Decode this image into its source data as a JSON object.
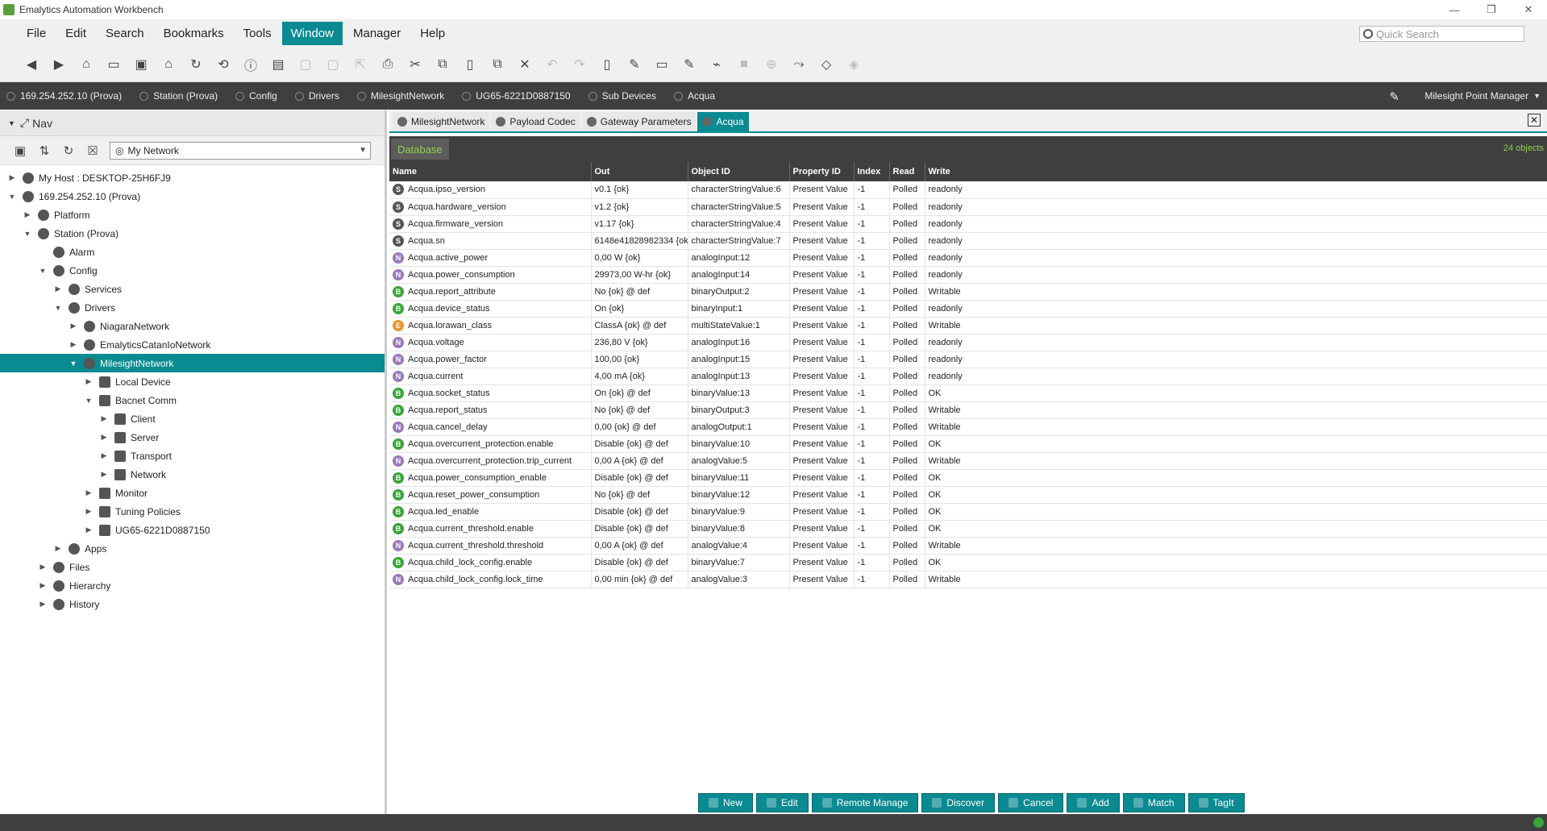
{
  "window": {
    "title": "Emalytics Automation Workbench",
    "btn_min": "—",
    "btn_max": "❐",
    "btn_close": "✕"
  },
  "menubar": {
    "items": [
      "File",
      "Edit",
      "Search",
      "Bookmarks",
      "Tools",
      "Window",
      "Manager",
      "Help"
    ],
    "active_index": 5,
    "quick_search_placeholder": "Quick Search"
  },
  "toolbar": {
    "icons": [
      "back-icon",
      "forward-icon",
      "home-folder-icon",
      "layout-icon",
      "capture-icon",
      "home-icon",
      "refresh-icon",
      "history-icon",
      "info-icon",
      "open-folder-icon",
      "save-icon",
      "save-all-icon",
      "export-icon",
      "print-icon",
      "cut-icon",
      "copy-icon",
      "paste-icon",
      "duplicate-icon",
      "delete-icon",
      "undo-icon",
      "redo-icon",
      "new-doc-icon",
      "rename-icon",
      "window-icon",
      "edit-pen-icon",
      "plug-icon",
      "stop-icon",
      "target-icon",
      "link-icon",
      "tag-icon",
      "tag-search-icon"
    ]
  },
  "pathbar": {
    "crumbs": [
      "169.254.252.10 (Prova)",
      "Station (Prova)",
      "Config",
      "Drivers",
      "MilesightNetwork",
      "UG65-6221D0887150",
      "Sub Devices",
      "Acqua"
    ],
    "view_selector": "Milesight Point Manager"
  },
  "nav": {
    "title": "Nav",
    "selector": "My Network",
    "tree": [
      {
        "label": "My Host : DESKTOP-25H6FJ9",
        "depth": 0,
        "toggle": "▶"
      },
      {
        "label": "169.254.252.10 (Prova)",
        "depth": 0,
        "toggle": "▼"
      },
      {
        "label": "Platform",
        "depth": 1,
        "toggle": "▶"
      },
      {
        "label": "Station (Prova)",
        "depth": 1,
        "toggle": "▼"
      },
      {
        "label": "Alarm",
        "depth": 2,
        "toggle": ""
      },
      {
        "label": "Config",
        "depth": 2,
        "toggle": "▼"
      },
      {
        "label": "Services",
        "depth": 3,
        "toggle": "▶"
      },
      {
        "label": "Drivers",
        "depth": 3,
        "toggle": "▼"
      },
      {
        "label": "NiagaraNetwork",
        "depth": 4,
        "toggle": "▶"
      },
      {
        "label": "EmalyticsCatanIoNetwork",
        "depth": 4,
        "toggle": "▶"
      },
      {
        "label": "MilesightNetwork",
        "depth": 4,
        "toggle": "▼",
        "selected": true
      },
      {
        "label": "Local Device",
        "depth": 5,
        "toggle": "▶"
      },
      {
        "label": "Bacnet Comm",
        "depth": 5,
        "toggle": "▼"
      },
      {
        "label": "Client",
        "depth": 6,
        "toggle": "▶"
      },
      {
        "label": "Server",
        "depth": 6,
        "toggle": "▶"
      },
      {
        "label": "Transport",
        "depth": 6,
        "toggle": "▶"
      },
      {
        "label": "Network",
        "depth": 6,
        "toggle": "▶"
      },
      {
        "label": "Monitor",
        "depth": 5,
        "toggle": "▶"
      },
      {
        "label": "Tuning Policies",
        "depth": 5,
        "toggle": "▶"
      },
      {
        "label": "UG65-6221D0887150",
        "depth": 5,
        "toggle": "▶"
      },
      {
        "label": "Apps",
        "depth": 3,
        "toggle": "▶"
      },
      {
        "label": "Files",
        "depth": 2,
        "toggle": "▶"
      },
      {
        "label": "Hierarchy",
        "depth": 2,
        "toggle": "▶"
      },
      {
        "label": "History",
        "depth": 2,
        "toggle": "▶"
      }
    ]
  },
  "tabs": [
    "MilesightNetwork",
    "Payload Codec",
    "Gateway Parameters",
    "Acqua"
  ],
  "database": {
    "label": "Database",
    "count": "24 objects",
    "columns": [
      "Name",
      "Out",
      "Object ID",
      "Property ID",
      "Index",
      "Read",
      "Write"
    ],
    "rows": [
      {
        "type": "S",
        "name": "Acqua.ipso_version",
        "out": "v0.1 {ok}",
        "oid": "characterStringValue:6",
        "pid": "Present Value",
        "idx": "-1",
        "read": "Polled",
        "write": "readonly"
      },
      {
        "type": "S",
        "name": "Acqua.hardware_version",
        "out": "v1.2 {ok}",
        "oid": "characterStringValue:5",
        "pid": "Present Value",
        "idx": "-1",
        "read": "Polled",
        "write": "readonly"
      },
      {
        "type": "S",
        "name": "Acqua.firmware_version",
        "out": "v1.17 {ok}",
        "oid": "characterStringValue:4",
        "pid": "Present Value",
        "idx": "-1",
        "read": "Polled",
        "write": "readonly"
      },
      {
        "type": "S",
        "name": "Acqua.sn",
        "out": "6148e41828982334 {ok}",
        "oid": "characterStringValue:7",
        "pid": "Present Value",
        "idx": "-1",
        "read": "Polled",
        "write": "readonly"
      },
      {
        "type": "N",
        "name": "Acqua.active_power",
        "out": "0,00 W {ok}",
        "oid": "analogInput:12",
        "pid": "Present Value",
        "idx": "-1",
        "read": "Polled",
        "write": "readonly"
      },
      {
        "type": "N",
        "name": "Acqua.power_consumption",
        "out": "29973,00 W-hr {ok}",
        "oid": "analogInput:14",
        "pid": "Present Value",
        "idx": "-1",
        "read": "Polled",
        "write": "readonly"
      },
      {
        "type": "B",
        "name": "Acqua.report_attribute",
        "out": "No {ok} @ def",
        "oid": "binaryOutput:2",
        "pid": "Present Value",
        "idx": "-1",
        "read": "Polled",
        "write": "Writable"
      },
      {
        "type": "B",
        "name": "Acqua.device_status",
        "out": "On {ok}",
        "oid": "binaryInput:1",
        "pid": "Present Value",
        "idx": "-1",
        "read": "Polled",
        "write": "readonly"
      },
      {
        "type": "E",
        "name": "Acqua.lorawan_class",
        "out": "ClassA {ok} @ def",
        "oid": "multiStateValue:1",
        "pid": "Present Value",
        "idx": "-1",
        "read": "Polled",
        "write": "Writable"
      },
      {
        "type": "N",
        "name": "Acqua.voltage",
        "out": "236,80 V {ok}",
        "oid": "analogInput:16",
        "pid": "Present Value",
        "idx": "-1",
        "read": "Polled",
        "write": "readonly"
      },
      {
        "type": "N",
        "name": "Acqua.power_factor",
        "out": "100,00 {ok}",
        "oid": "analogInput:15",
        "pid": "Present Value",
        "idx": "-1",
        "read": "Polled",
        "write": "readonly"
      },
      {
        "type": "N",
        "name": "Acqua.current",
        "out": "4,00 mA {ok}",
        "oid": "analogInput:13",
        "pid": "Present Value",
        "idx": "-1",
        "read": "Polled",
        "write": "readonly"
      },
      {
        "type": "B",
        "name": "Acqua.socket_status",
        "out": "On {ok} @ def",
        "oid": "binaryValue:13",
        "pid": "Present Value",
        "idx": "-1",
        "read": "Polled",
        "write": "OK"
      },
      {
        "type": "B",
        "name": "Acqua.report_status",
        "out": "No {ok} @ def",
        "oid": "binaryOutput:3",
        "pid": "Present Value",
        "idx": "-1",
        "read": "Polled",
        "write": "Writable"
      },
      {
        "type": "N",
        "name": "Acqua.cancel_delay",
        "out": "0,00 {ok} @ def",
        "oid": "analogOutput:1",
        "pid": "Present Value",
        "idx": "-1",
        "read": "Polled",
        "write": "Writable"
      },
      {
        "type": "B",
        "name": "Acqua.overcurrent_protection.enable",
        "out": "Disable {ok} @ def",
        "oid": "binaryValue:10",
        "pid": "Present Value",
        "idx": "-1",
        "read": "Polled",
        "write": "OK"
      },
      {
        "type": "N",
        "name": "Acqua.overcurrent_protection.trip_current",
        "out": "0,00 A {ok} @ def",
        "oid": "analogValue:5",
        "pid": "Present Value",
        "idx": "-1",
        "read": "Polled",
        "write": "Writable"
      },
      {
        "type": "B",
        "name": "Acqua.power_consumption_enable",
        "out": "Disable {ok} @ def",
        "oid": "binaryValue:11",
        "pid": "Present Value",
        "idx": "-1",
        "read": "Polled",
        "write": "OK"
      },
      {
        "type": "B",
        "name": "Acqua.reset_power_consumption",
        "out": "No {ok} @ def",
        "oid": "binaryValue:12",
        "pid": "Present Value",
        "idx": "-1",
        "read": "Polled",
        "write": "OK"
      },
      {
        "type": "B",
        "name": "Acqua.led_enable",
        "out": "Disable {ok} @ def",
        "oid": "binaryValue:9",
        "pid": "Present Value",
        "idx": "-1",
        "read": "Polled",
        "write": "OK"
      },
      {
        "type": "B",
        "name": "Acqua.current_threshold.enable",
        "out": "Disable {ok} @ def",
        "oid": "binaryValue:8",
        "pid": "Present Value",
        "idx": "-1",
        "read": "Polled",
        "write": "OK"
      },
      {
        "type": "N",
        "name": "Acqua.current_threshold.threshold",
        "out": "0,00 A {ok} @ def",
        "oid": "analogValue:4",
        "pid": "Present Value",
        "idx": "-1",
        "read": "Polled",
        "write": "Writable"
      },
      {
        "type": "B",
        "name": "Acqua.child_lock_config.enable",
        "out": "Disable {ok} @ def",
        "oid": "binaryValue:7",
        "pid": "Present Value",
        "idx": "-1",
        "read": "Polled",
        "write": "OK"
      },
      {
        "type": "N",
        "name": "Acqua.child_lock_config.lock_time",
        "out": "0,00 min {ok} @ def",
        "oid": "analogValue:3",
        "pid": "Present Value",
        "idx": "-1",
        "read": "Polled",
        "write": "Writable"
      }
    ]
  },
  "actions": [
    "New",
    "Edit",
    "Remote Manage",
    "Discover",
    "Cancel",
    "Add",
    "Match",
    "TagIt"
  ],
  "colors": {
    "accent": "#0a8a91",
    "dark_bar": "#3f3f3f",
    "count_green": "#8fd14f",
    "badge_S": "#555555",
    "badge_N": "#9b79b9",
    "badge_B": "#3aa33a",
    "badge_E": "#e8942e"
  }
}
